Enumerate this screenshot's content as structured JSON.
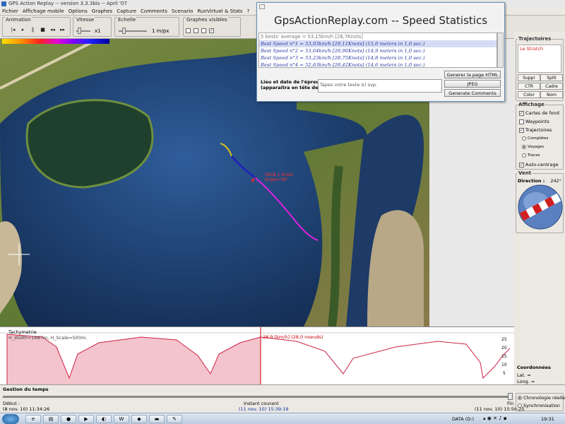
{
  "window": {
    "title": "GPS Action Replay  --  version 3.3.3bis -- April '07"
  },
  "menu": [
    "Fichier",
    "Affichage mobile",
    "Options",
    "Graphes",
    "Capture",
    "Comments",
    "Scenario",
    "RunVirtuel & Stats",
    "?"
  ],
  "toolbar": {
    "animation_label": "Animation",
    "vitesse_label": "Vitesse",
    "vitesse_value": "x1",
    "echelle_label": "Echelle",
    "echelle_value": "1 m/px",
    "graphes_label": "Graphes visibles"
  },
  "map": {
    "track_label_speed": "Vit28,1 knots",
    "track_label_angle": "Angle=18°",
    "colors": {
      "yellow": "#d8c020",
      "blue": "#2020c0",
      "magenta": "#e020e0",
      "red": "#d03030"
    }
  },
  "dialog": {
    "title": "GpsActionReplay.com -- Speed Statistics",
    "list": [
      "5 bests' average = 53,15km/h [28,7Knots]",
      "Best Speed n°1 = 53,93km/h [29,11Knots]   (15,0 meters in 1,0 sec.)",
      "Best Speed n°2 = 53,64km/h [28,96Knots]   (14,9 meters in 1,0 sec.)",
      "Best Speed n°3 = 53,23km/h [28,75Knots]   (14,8 meters in 1,0 sec.)",
      "Best Speed n°4 = 52,63km/h [28,42Knots]   (14,6 meters in 1,0 sec.)"
    ],
    "lieu_label_1": "Lieu et date de l'épreuve:",
    "lieu_label_2": "(apparaitra en tête de page)",
    "lieu_placeholder": "Tapez votre texte ici svp.",
    "btn_html": "Generer la page HTML",
    "btn_jpeg": "JPEG",
    "btn_comments": "Generate Comments"
  },
  "sidebar": {
    "trajectoires_label": "Trajectoires",
    "trajectoire_item": "Le Stratch",
    "btn_suppr": "Suppr",
    "btn_split": "Split",
    "btn_ctr": "CTR",
    "btn_cadre": "Cadre",
    "btn_color": "Color",
    "btn_nom": "Nom",
    "affichage_label": "Affichage",
    "cartes_de_fond": "Cartes de fond",
    "waypoints": "Waypoints",
    "trajectoires": "Trajectoires",
    "completes": "Complètes",
    "vsvoyages": "Voyages",
    "traces": "Traces",
    "auto_centrage": "Auto-centrage",
    "vent_label": "Vent",
    "direction_label": "Direction :",
    "direction_value": "242°"
  },
  "profile": {
    "title": "Tachymetrie",
    "info": "H_Width=1687m, H_Scale=500m.",
    "cursor_label": "28,9 [km/h] (28,0 noeuds)",
    "y_ticks": [
      "25",
      "20",
      "15",
      "10",
      "5"
    ]
  },
  "coords": {
    "label": "Coordonnées",
    "lat": "Lat. =",
    "long": "Long. ="
  },
  "timeline": {
    "label": "Gestion du temps",
    "debut_label": "Début :",
    "debut_value": "(8 nov. 10) 11:34:26",
    "instant_label": "Instant courant",
    "instant_value": "(11 nov. 10) 15:39:19",
    "fin_label": "Fin :",
    "fin_value": "(11 nov. 10) 15:56:25",
    "chrono": "Chronologie réelle",
    "sync": "Synchronisation"
  },
  "taskbar": {
    "tray_text": "DATA (D:)",
    "clock": "19:31"
  }
}
